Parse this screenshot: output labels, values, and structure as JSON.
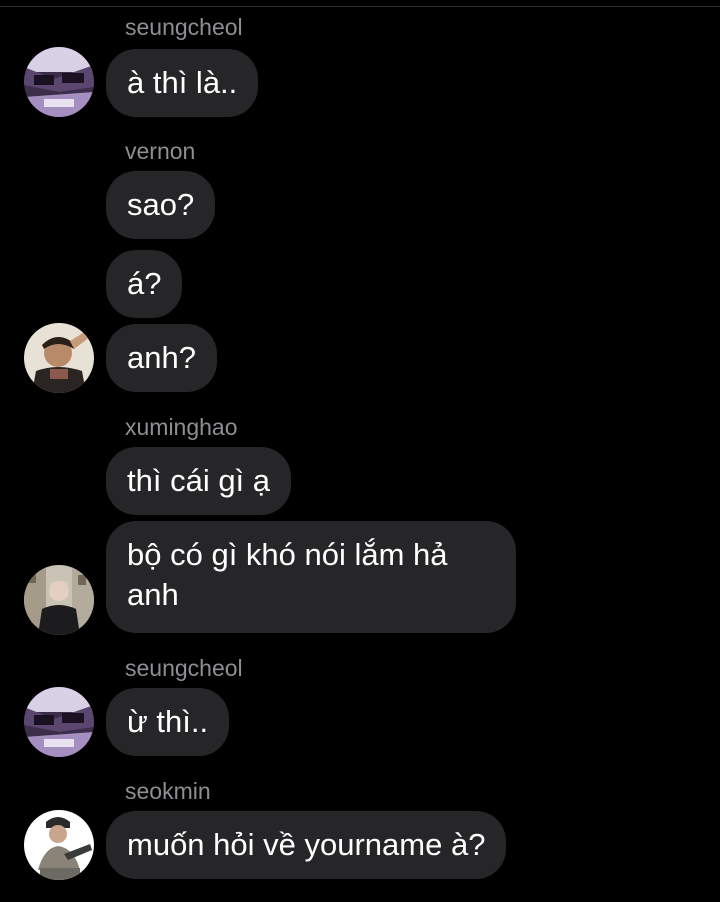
{
  "colors": {
    "background": "#000000",
    "bubble": "#262628",
    "sender_name": "#8e8e93",
    "message_text": "#ffffff"
  },
  "chat": {
    "senders": {
      "s1": "seungcheol",
      "s2": "vernon",
      "s3": "xuminghao",
      "s4": "seungcheol",
      "s5": "seokmin"
    },
    "messages": {
      "m1": "à thì là..",
      "m2": "sao?",
      "m3": "á?",
      "m4": "anh?",
      "m5": "thì cái gì ạ",
      "m6": "bộ có gì khó nói lắm hả anh",
      "m7": "ừ thì..",
      "m8": "muốn hỏi về yourname à?"
    },
    "avatars": {
      "seungcheol": "avatar-seungcheol",
      "vernon": "avatar-vernon",
      "xuminghao": "avatar-xuminghao",
      "seokmin": "avatar-seokmin"
    }
  }
}
